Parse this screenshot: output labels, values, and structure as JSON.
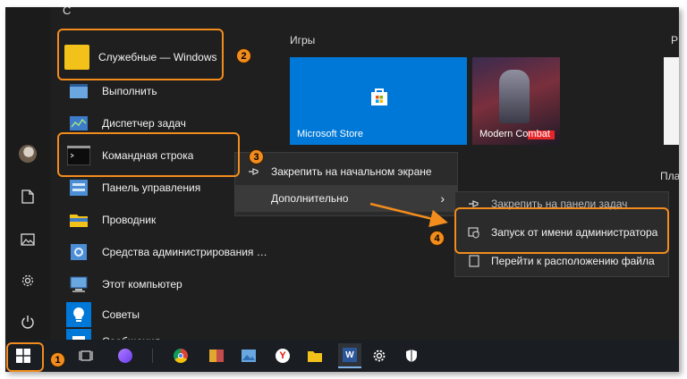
{
  "start_menu": {
    "group_letter": "С",
    "folder": {
      "label": "Служебные — Windows"
    },
    "apps": [
      {
        "label": "Выполнить"
      },
      {
        "label": "Диспетчер задач"
      },
      {
        "label": "Командная строка"
      },
      {
        "label": "Панель управления"
      },
      {
        "label": "Проводник"
      },
      {
        "label": "Средства администрирования Wi..."
      },
      {
        "label": "Этот компьютер"
      },
      {
        "label": "Советы"
      },
      {
        "label": "Сообщения"
      }
    ]
  },
  "tiles": {
    "section_games": "Игры",
    "section_cut": "Р",
    "section_pla": "Пла",
    "store": {
      "label": "Microsoft Store",
      "color": "#0078d7"
    },
    "game": {
      "label": "Modern Combat"
    }
  },
  "context_menu": {
    "items": [
      {
        "label": "Закрепить на начальном экране"
      },
      {
        "label": "Дополнительно",
        "arrow": "›"
      }
    ]
  },
  "submenu": {
    "items": [
      {
        "label": "Закрепить на панели задач"
      },
      {
        "label": "Запуск от имени администратора"
      },
      {
        "label": "Перейти к расположению файла"
      }
    ]
  },
  "steps": [
    "1",
    "2",
    "3",
    "4"
  ],
  "colors": {
    "accent": "#f28c1d",
    "highlight_border": "#f28c1d"
  }
}
